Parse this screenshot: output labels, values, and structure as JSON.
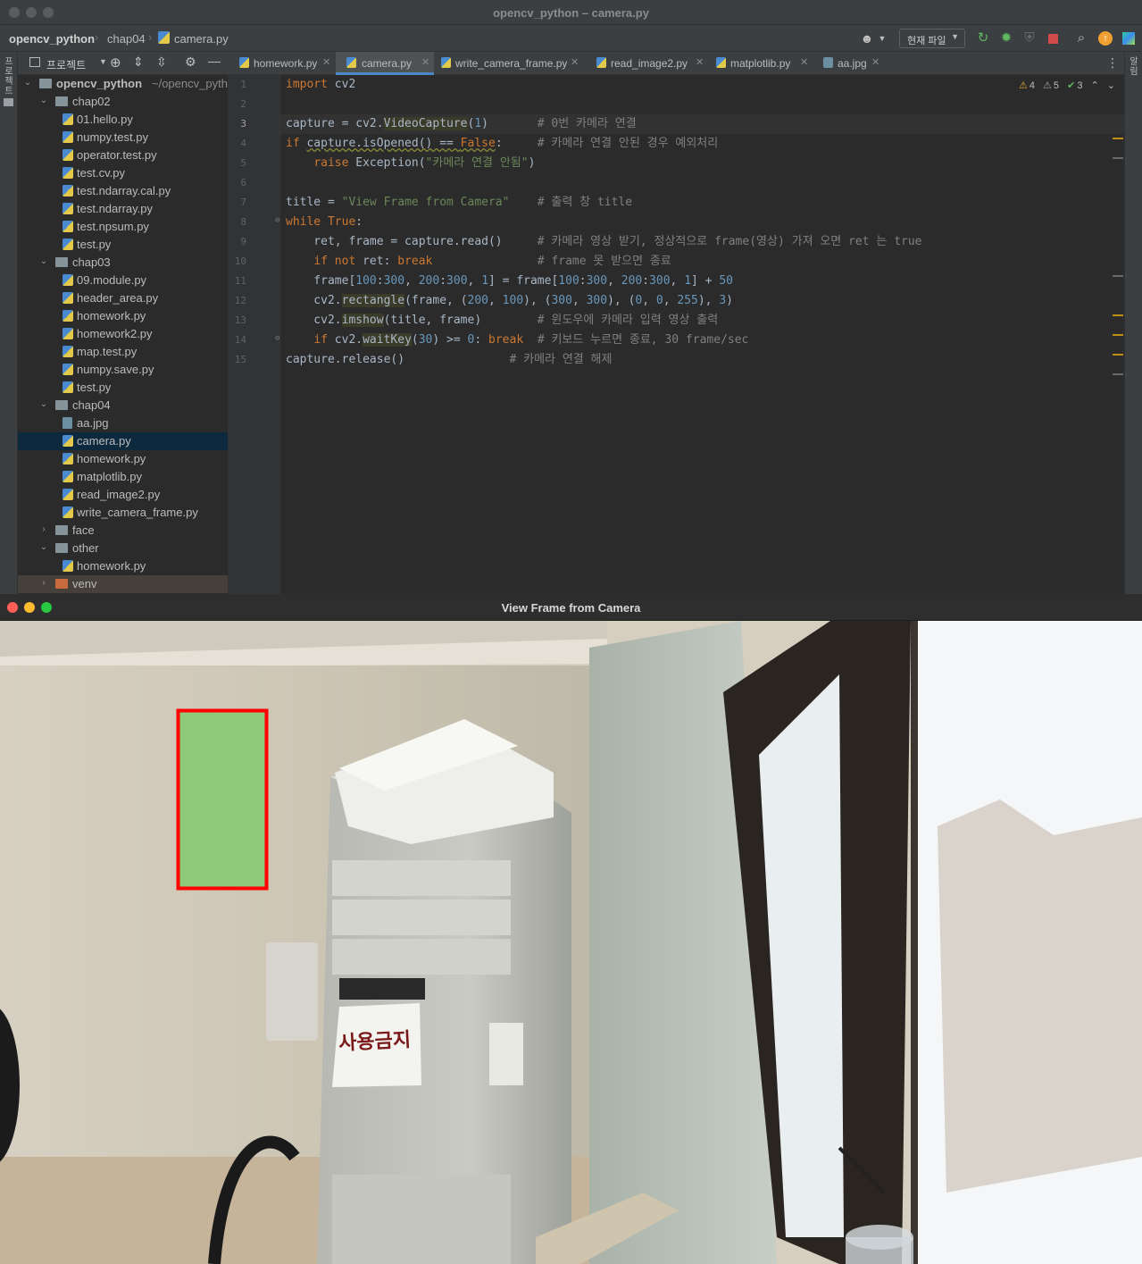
{
  "ide": {
    "window_title": "opencv_python – camera.py",
    "breadcrumb": [
      "opencv_python",
      "chap04",
      "camera.py"
    ],
    "run_config": "현재 파일",
    "project_panel_label": "프로젝트",
    "left_strip_label": "프로젝트",
    "right_strip_label": "알림",
    "tree": [
      {
        "label": "opencv_python",
        "path": "~/opencv_pyth",
        "type": "root"
      },
      {
        "label": "chap02",
        "type": "folder"
      },
      {
        "label": "01.hello.py",
        "type": "py"
      },
      {
        "label": "numpy.test.py",
        "type": "py"
      },
      {
        "label": "operator.test.py",
        "type": "py"
      },
      {
        "label": "test.cv.py",
        "type": "py"
      },
      {
        "label": "test.ndarray.cal.py",
        "type": "py"
      },
      {
        "label": "test.ndarray.py",
        "type": "py"
      },
      {
        "label": "test.npsum.py",
        "type": "py"
      },
      {
        "label": "test.py",
        "type": "py"
      },
      {
        "label": "chap03",
        "type": "folder"
      },
      {
        "label": "09.module.py",
        "type": "py"
      },
      {
        "label": "header_area.py",
        "type": "py"
      },
      {
        "label": "homework.py",
        "type": "py"
      },
      {
        "label": "homework2.py",
        "type": "py"
      },
      {
        "label": "map.test.py",
        "type": "py"
      },
      {
        "label": "numpy.save.py",
        "type": "py"
      },
      {
        "label": "test.py",
        "type": "py"
      },
      {
        "label": "chap04",
        "type": "folder"
      },
      {
        "label": "aa.jpg",
        "type": "img"
      },
      {
        "label": "camera.py",
        "type": "py",
        "selected": true
      },
      {
        "label": "homework.py",
        "type": "py"
      },
      {
        "label": "matplotlib.py",
        "type": "py"
      },
      {
        "label": "read_image2.py",
        "type": "py"
      },
      {
        "label": "write_camera_frame.py",
        "type": "py"
      },
      {
        "label": "face",
        "type": "folder"
      },
      {
        "label": "other",
        "type": "folder"
      },
      {
        "label": "homework.py",
        "type": "py"
      },
      {
        "label": "venv",
        "type": "folder"
      }
    ],
    "tabs": [
      "homework.py",
      "camera.py",
      "write_camera_frame.py",
      "read_image2.py",
      "matplotlib.py",
      "aa.jpg"
    ],
    "active_tab": "camera.py",
    "inspections": {
      "warnings": "4",
      "weak_warnings": "5",
      "typos": "3"
    },
    "line_numbers": [
      "1",
      "2",
      "3",
      "4",
      "5",
      "6",
      "7",
      "8",
      "9",
      "10",
      "11",
      "12",
      "13",
      "14",
      "15"
    ],
    "code_comments": {
      "l3": "# 0번 카메라 연결",
      "l4": "# 카메라 연결 안된 경우 예외처리",
      "l5_str": "\"카메라 연결 안됨\"",
      "l7_str": "\"View Frame from Camera\"",
      "l7": "# 출력 창 title",
      "l9": "# 카메라 영상 받기, 정상적으로 frame(영상) 가져 오면 ret 는 true",
      "l10": "# frame 못 받으면 종료",
      "l13": "# 윈도우에 카메라 입력 영상 출력",
      "l14": "# 키보드 누르면 종료, 30 frame/sec",
      "l15": "# 카메라 연결 해제"
    }
  },
  "camera_window": {
    "title": "View Frame from Camera",
    "sign_text": "사용금지"
  },
  "colors": {
    "keyword": "#cc7832",
    "string": "#6a8759",
    "number": "#6897bb",
    "comment": "#808080",
    "rect_outline": "#ff0000",
    "brightened_region": "#8fc97a"
  }
}
